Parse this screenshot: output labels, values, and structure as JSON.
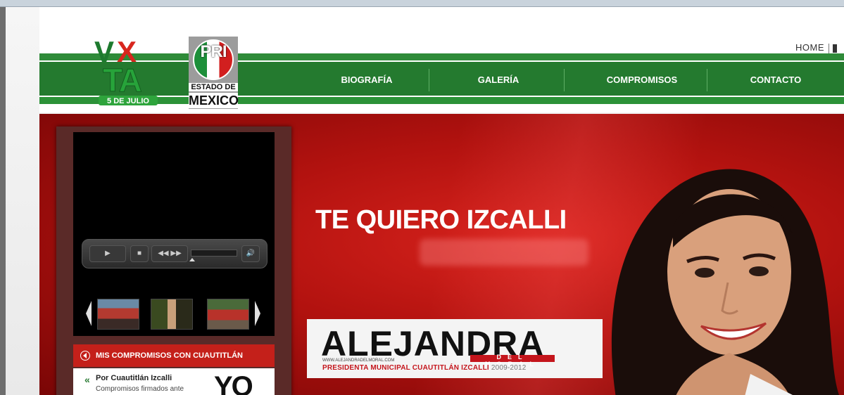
{
  "header": {
    "top_links": {
      "home": "HOME"
    },
    "logo": {
      "line1": "VXTA",
      "line2": "5 DE JULIO"
    },
    "pri": {
      "letters": "PRI",
      "line1": "ESTADO DE",
      "line2": "MEXICO"
    },
    "nav": [
      "BIOGRAFÍA",
      "GALERÍA",
      "COMPROMISOS",
      "CONTACTO"
    ]
  },
  "banner": {
    "slogan": "TE QUIERO IZCALLI",
    "name": "ALEJANDRA",
    "surname": "DEL MORAL",
    "url": "WWW.ALEJANDRADELMORAL.COM",
    "subtitle": "PRESIDENTA MUNICIPAL CUAUTITLÁN IZCALLI",
    "years": "2009-2012"
  },
  "video": {
    "controls": {
      "play": "▶",
      "stop": "■",
      "rewind": "◀◀",
      "forward": "▶▶",
      "volume": "🔊"
    }
  },
  "compromisos": {
    "header": "MIS COMPROMISOS CON CUAUTITLÁN  IZCALLI",
    "item_title": "Por Cuautitlán Izcalli",
    "item_desc": "Compromisos firmados ante",
    "graphic_text": "YO"
  },
  "colors": {
    "green": "#247a2f",
    "red": "#c4201a",
    "dark_red": "#7a0606"
  }
}
